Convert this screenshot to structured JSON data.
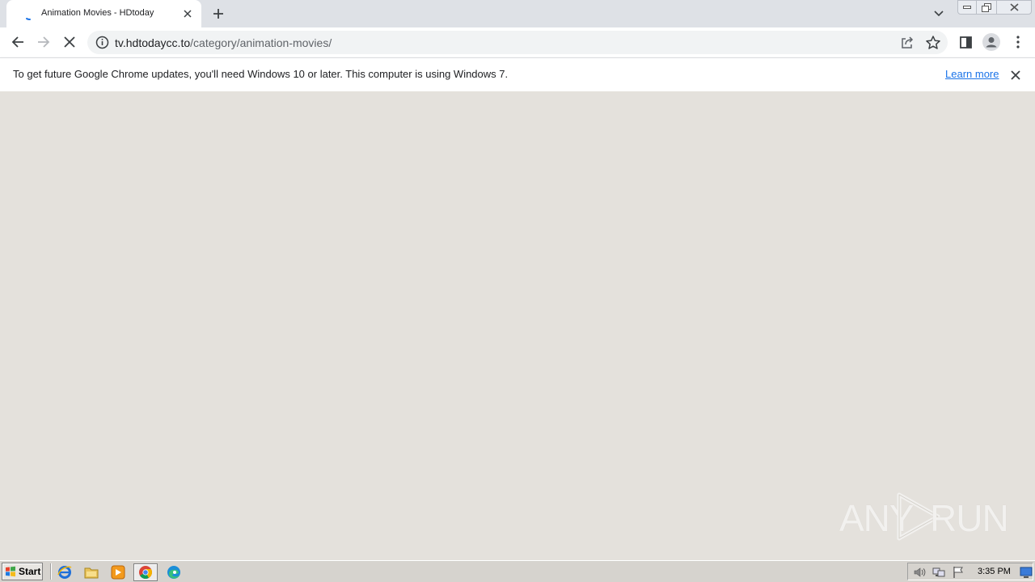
{
  "tab": {
    "title": "Animation Movies - HDtoday"
  },
  "toolbar": {
    "url_host": "tv.hdtodaycc.to",
    "url_path": "/category/animation-movies/"
  },
  "infobar": {
    "message": "To get future Google Chrome updates, you'll need Windows 10 or later. This computer is using Windows 7.",
    "link": "Learn more"
  },
  "watermark": {
    "left": "ANY",
    "right": "RUN"
  },
  "taskbar": {
    "start_label": "Start",
    "clock": "3:35 PM"
  },
  "colors": {
    "page_bg": "#e4e1dc",
    "link": "#1a73e8",
    "tabstrip": "#dee1e6"
  }
}
